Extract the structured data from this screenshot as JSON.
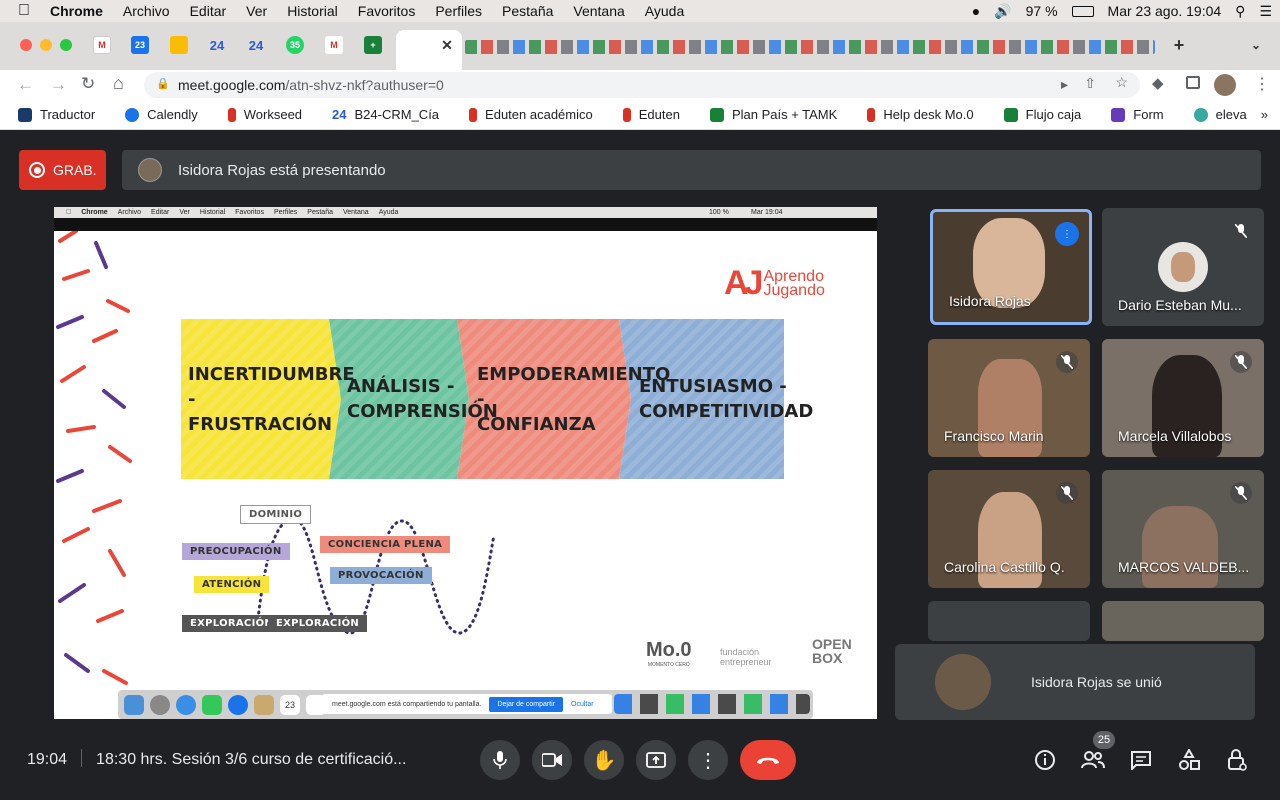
{
  "menubar": {
    "apple": "",
    "app": "Chrome",
    "items": [
      "Archivo",
      "Editar",
      "Ver",
      "Historial",
      "Favoritos",
      "Perfiles",
      "Pestaña",
      "Ventana",
      "Ayuda"
    ],
    "battery": "97 %",
    "clock": "Mar 23 ago.  19:04"
  },
  "browser": {
    "url_host": "meet.google.com",
    "url_path": "/atn-shvz-nkf?authuser=0",
    "tab_badges": [
      "24",
      "24",
      "35"
    ],
    "bookmarks": [
      {
        "label": "Traductor",
        "color": "#1a3a6b"
      },
      {
        "label": "Calendly",
        "color": "#1a73e8"
      },
      {
        "label": "Workseed",
        "color": "#d93025"
      },
      {
        "label": "B24-CRM_Cía",
        "color": "#2a5bd7"
      },
      {
        "label": "Eduten académico",
        "color": "#d93025"
      },
      {
        "label": "Eduten",
        "color": "#d93025"
      },
      {
        "label": "Plan País + TAMK",
        "color": "#188038"
      },
      {
        "label": "Help desk Mo.0",
        "color": "#d93025"
      },
      {
        "label": "Flujo caja",
        "color": "#188038"
      },
      {
        "label": "Form",
        "color": "#673ab7"
      },
      {
        "label": "eleva",
        "color": "#3aa8a0"
      }
    ]
  },
  "meet": {
    "rec_label": "GRAB.",
    "presenting": "Isidora Rojas está presentando",
    "slide": {
      "inner_menu": [
        "Chrome",
        "Archivo",
        "Editar",
        "Ver",
        "Historial",
        "Favoritos",
        "Perfiles",
        "Pestaña",
        "Ventana",
        "Ayuda"
      ],
      "inner_clock": "Mar 19:04",
      "inner_battery": "100 %",
      "logo_line1": "Aprendo",
      "logo_line2": "Jugando",
      "logo_mark": "AJ",
      "stages": [
        {
          "l1": "INCERTIDUMBRE -",
          "l2": "FRUSTRACIÓN",
          "color": "#f7e43a"
        },
        {
          "l1": "ANÁLISIS -",
          "l2": "COMPRENSIÓN",
          "color": "#6cc4a1"
        },
        {
          "l1": "EMPODERAMIENTO -",
          "l2": "CONFIANZA",
          "color": "#ee8b7d"
        },
        {
          "l1": "ENTUSIASMO -",
          "l2": "COMPETITIVIDAD",
          "color": "#8eaed6"
        }
      ],
      "labels": {
        "dominio": "DOMINIO",
        "preocupacion": "PREOCUPACIÓN",
        "atencion": "ATENCIÓN",
        "exploracion1": "EXPLORACIÓN",
        "exploracion2": "EXPLORACIÓN",
        "conciencia": "CONCIENCIA PLENA",
        "provocacion": "PROVOCACIÓN"
      },
      "sponsors": {
        "mo0": "Mo.0",
        "mo0_sub": "MOMENTO CERO",
        "fundacion": "fundación entrepreneur",
        "openbox": "OPEN BOX"
      },
      "share_text": "meet.google.com está compartiendo tu pantalla.",
      "share_stop": "Dejar de compartir",
      "share_hide": "Ocultar",
      "dock_date": "23"
    },
    "participants": [
      {
        "name": "Isidora Rojas",
        "speaking": true,
        "bg": "#4a3d30"
      },
      {
        "name": "Dario Esteban Mu...",
        "muted": true,
        "bg": "#3c4043"
      },
      {
        "name": "Francisco Marin",
        "muted": true,
        "bg": "#6e5a44"
      },
      {
        "name": "Marcela Villalobos",
        "muted": true,
        "bg": "#7a7068"
      },
      {
        "name": "Carolina Castillo Q.",
        "muted": true,
        "bg": "#5a4a3c"
      },
      {
        "name": "MARCOS VALDEB...",
        "muted": true,
        "bg": "#5c5a52"
      }
    ],
    "toast": "Isidora Rojas se unió",
    "time": "19:04",
    "meeting_title": "18:30 hrs. Sesión 3/6 curso de certificació...",
    "people_count": "25"
  }
}
